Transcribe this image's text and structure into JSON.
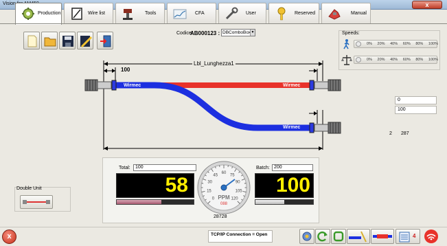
{
  "window": {
    "title": "Vision for AM450",
    "close_glyph": "x"
  },
  "tabs": [
    {
      "label": "Production",
      "icon": "gear-icon",
      "active": true
    },
    {
      "label": "Wire list",
      "icon": "notebook-icon"
    },
    {
      "label": "Tools",
      "icon": "crimp-tool-icon"
    },
    {
      "label": "CFA",
      "icon": "cfa-graph-icon"
    },
    {
      "label": "User",
      "icon": "wrench-icon"
    },
    {
      "label": "Reserved",
      "icon": "key-icon"
    },
    {
      "label": "Manual",
      "icon": "hand-icon"
    }
  ],
  "toolbar": {
    "buttons": [
      "new-file-icon",
      "open-folder-icon",
      "save-icon",
      "edit-icon",
      "exit-door-icon"
    ]
  },
  "codice": {
    "label": "Codice:",
    "value": "AB000123 :",
    "select_value": "DBComboBoxE"
  },
  "speeds": {
    "label": "Speeds:",
    "ticks": [
      "0%",
      "20%",
      "40%",
      "60%",
      "80%",
      "100%"
    ],
    "rows": [
      {
        "icon": "walking-person-icon"
      },
      {
        "icon": "scale-icon"
      }
    ]
  },
  "diagram": {
    "length_label": "Lbl_Lunghezza1",
    "strip_label": "100",
    "wire_top_left": "Wirmec",
    "wire_top_right": "Wirmec",
    "wire_bottom_right": "Wirmec",
    "colors": {
      "red_wire": "#e8322a",
      "blue_wire": "#1c2fe0"
    }
  },
  "right_values": {
    "box1": "0",
    "box2": "100",
    "val_a": "2",
    "val_b": "287"
  },
  "double_unit": {
    "label": "Double Unit"
  },
  "counter": {
    "total_label": "Total:",
    "total_value": "100",
    "batch_label": "Batch:",
    "batch_value": "200",
    "total_display": "58",
    "batch_display": "100",
    "total_progress": 0.58,
    "batch_progress": 0.5,
    "gauge": {
      "unit": "PPM",
      "ticks": [
        "15",
        "30",
        "45",
        "60",
        "75",
        "90",
        "105",
        "120"
      ],
      "zero": "0",
      "digital": "088"
    },
    "bottom_value": "28728"
  },
  "status": {
    "connection": "TCP/IP Connection = Open",
    "exit_glyph": "x",
    "count": "4"
  }
}
